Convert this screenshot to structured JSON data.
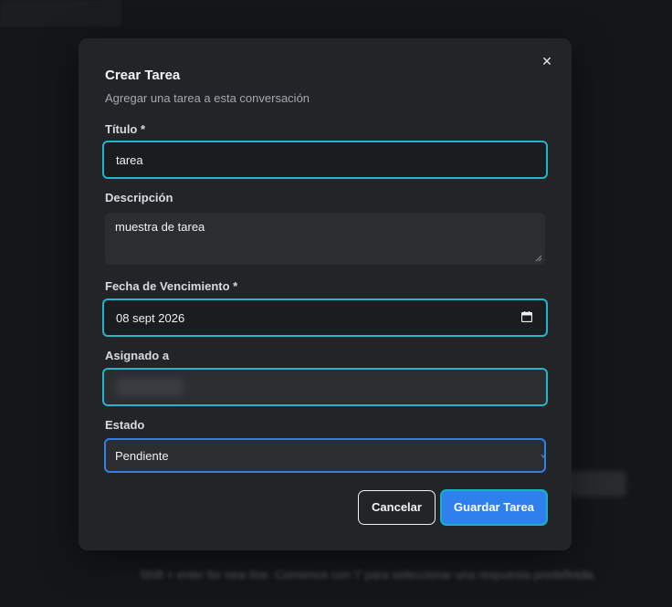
{
  "background": {
    "hint_text": "Shift + enter for new line. Comience con '/' para seleccionar una respuesta predefinida."
  },
  "modal": {
    "title": "Crear Tarea",
    "subtitle": "Agregar una tarea a esta conversación",
    "close_icon": "close-icon",
    "fields": {
      "title": {
        "label": "Título *",
        "value": "tarea"
      },
      "description": {
        "label": "Descripción",
        "value": "muestra de tarea"
      },
      "due_date": {
        "label": "Fecha de Vencimiento *",
        "value": "08 sept 2026",
        "icon": "calendar-icon"
      },
      "assigned": {
        "label": "Asignado a",
        "value": ""
      },
      "status": {
        "label": "Estado",
        "value": "Pendiente",
        "icon": "chevron-down-icon"
      }
    },
    "buttons": {
      "cancel": "Cancelar",
      "save": "Guardar Tarea"
    }
  },
  "colors": {
    "accent_focus": "#27b3c9",
    "primary_button": "#2f80ed",
    "select_border": "#2f7fe5"
  }
}
